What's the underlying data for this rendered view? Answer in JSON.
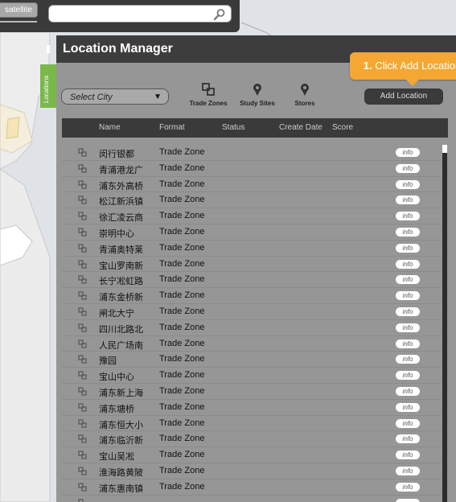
{
  "map": {
    "satellite_label": "satellite",
    "search": {
      "placeholder": "",
      "value": ""
    }
  },
  "panel": {
    "title": "Location Manager",
    "side_tab_label": "Locations",
    "select_city_label": "Select City",
    "tools": [
      {
        "label": "Trade Zones",
        "icon": "trade-zones-icon"
      },
      {
        "label": "Study Sites",
        "icon": "pin-icon"
      },
      {
        "label": "Stores",
        "icon": "pin-icon"
      }
    ],
    "add_location_label": "Add Location",
    "tooltip": {
      "step": "1.",
      "text": "Click Add Location"
    },
    "columns": [
      "Name",
      "Format",
      "Status",
      "Create Date",
      "Score"
    ],
    "rows": [
      {
        "name": "闵行银都",
        "format": "Trade Zone",
        "info": "info"
      },
      {
        "name": "青浦港龙广",
        "format": "Trade Zone",
        "info": "info"
      },
      {
        "name": "浦东外高桥",
        "format": "Trade Zone",
        "info": "info"
      },
      {
        "name": "松江新浜镇",
        "format": "Trade Zone",
        "info": "info"
      },
      {
        "name": "徐汇凌云商",
        "format": "Trade Zone",
        "info": "info"
      },
      {
        "name": "崇明中心",
        "format": "Trade Zone",
        "info": "info"
      },
      {
        "name": "青浦奥特莱",
        "format": "Trade Zone",
        "info": "info"
      },
      {
        "name": "宝山罗南新",
        "format": "Trade Zone",
        "info": "info"
      },
      {
        "name": "长宁凇虹路",
        "format": "Trade Zone",
        "info": "info"
      },
      {
        "name": "浦东金桥新",
        "format": "Trade Zone",
        "info": "info"
      },
      {
        "name": "闸北大宁",
        "format": "Trade Zone",
        "info": "info"
      },
      {
        "name": "四川北路北",
        "format": "Trade Zone",
        "info": "info"
      },
      {
        "name": "人民广场南",
        "format": "Trade Zone",
        "info": "info"
      },
      {
        "name": "豫园",
        "format": "Trade Zone",
        "info": "info"
      },
      {
        "name": "宝山中心",
        "format": "Trade Zone",
        "info": "info"
      },
      {
        "name": "浦东新上海",
        "format": "Trade Zone",
        "info": "info"
      },
      {
        "name": "浦东塘桥",
        "format": "Trade Zone",
        "info": "info"
      },
      {
        "name": "浦东恒大小",
        "format": "Trade Zone",
        "info": "info"
      },
      {
        "name": "浦东临沂新",
        "format": "Trade Zone",
        "info": "info"
      },
      {
        "name": "宝山吴凇",
        "format": "Trade Zone",
        "info": "info"
      },
      {
        "name": "淮海路黄陂",
        "format": "Trade Zone",
        "info": "info"
      },
      {
        "name": "浦东惠南镇",
        "format": "Trade Zone",
        "info": "info"
      },
      {
        "name": "",
        "format": "",
        "info": ""
      }
    ]
  }
}
